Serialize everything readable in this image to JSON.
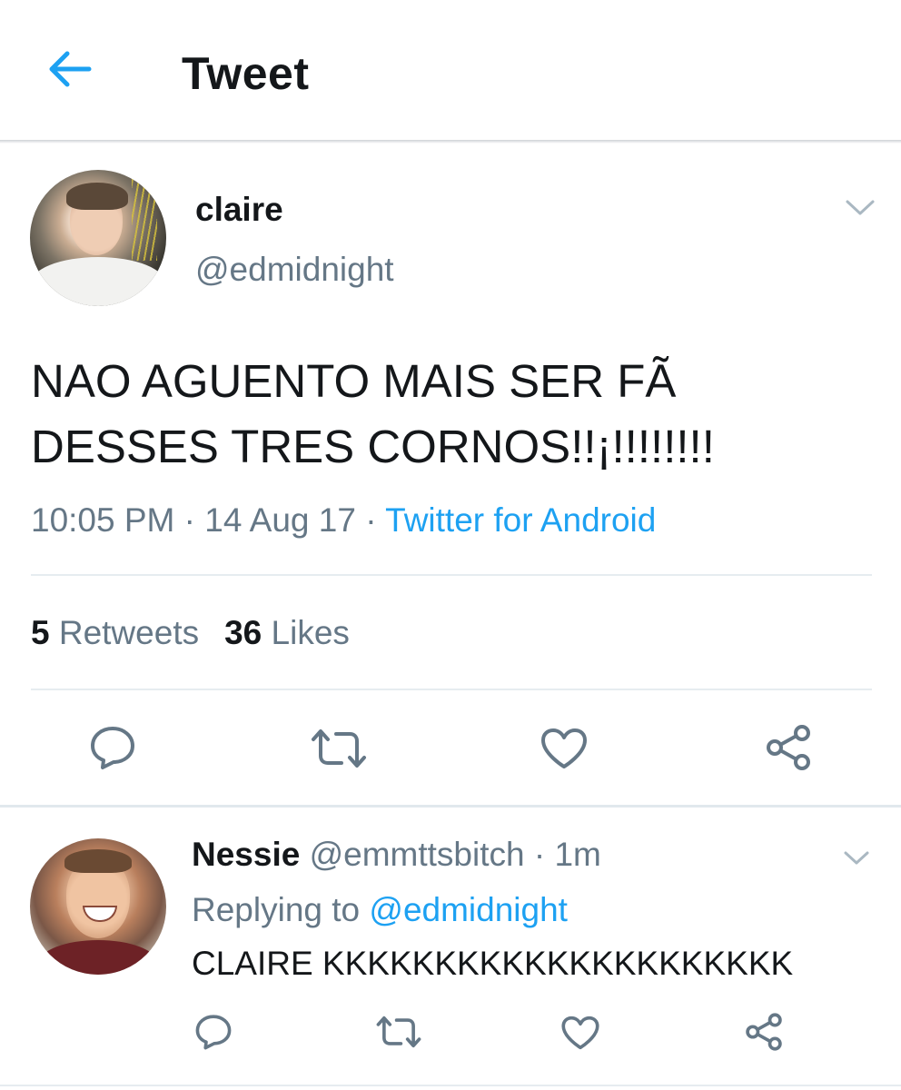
{
  "header": {
    "title": "Tweet",
    "back_icon": "arrow-left-icon"
  },
  "colors": {
    "accent": "#1da1f2",
    "secondary_text": "#657786",
    "primary_text": "#14171a",
    "icon_gray": "#657786"
  },
  "tweet": {
    "author_name": "claire",
    "author_handle": "@edmidnight",
    "text": "NAO AGUENTO MAIS SER FÃ\nDESSES TRES CORNOS!!¡!!!!!!!!",
    "time": "10:05 PM",
    "separator": " · ",
    "date": "14 Aug 17",
    "source": "Twitter for Android",
    "retweets_count": "5",
    "retweets_label": "Retweets",
    "likes_count": "36",
    "likes_label": "Likes",
    "actions": [
      "reply-icon",
      "retweet-icon",
      "like-icon",
      "share-icon"
    ]
  },
  "reply": {
    "author_name": "Nessie",
    "author_handle": "@emmttsbitch",
    "separator": " · ",
    "age": "1m",
    "replying_label": "Replying to",
    "replying_handle": "@edmidnight",
    "text": "CLAIRE KKKKKKKKKKKKKKKKKKKKK",
    "actions": [
      "reply-icon",
      "retweet-icon",
      "like-icon",
      "share-icon"
    ]
  }
}
